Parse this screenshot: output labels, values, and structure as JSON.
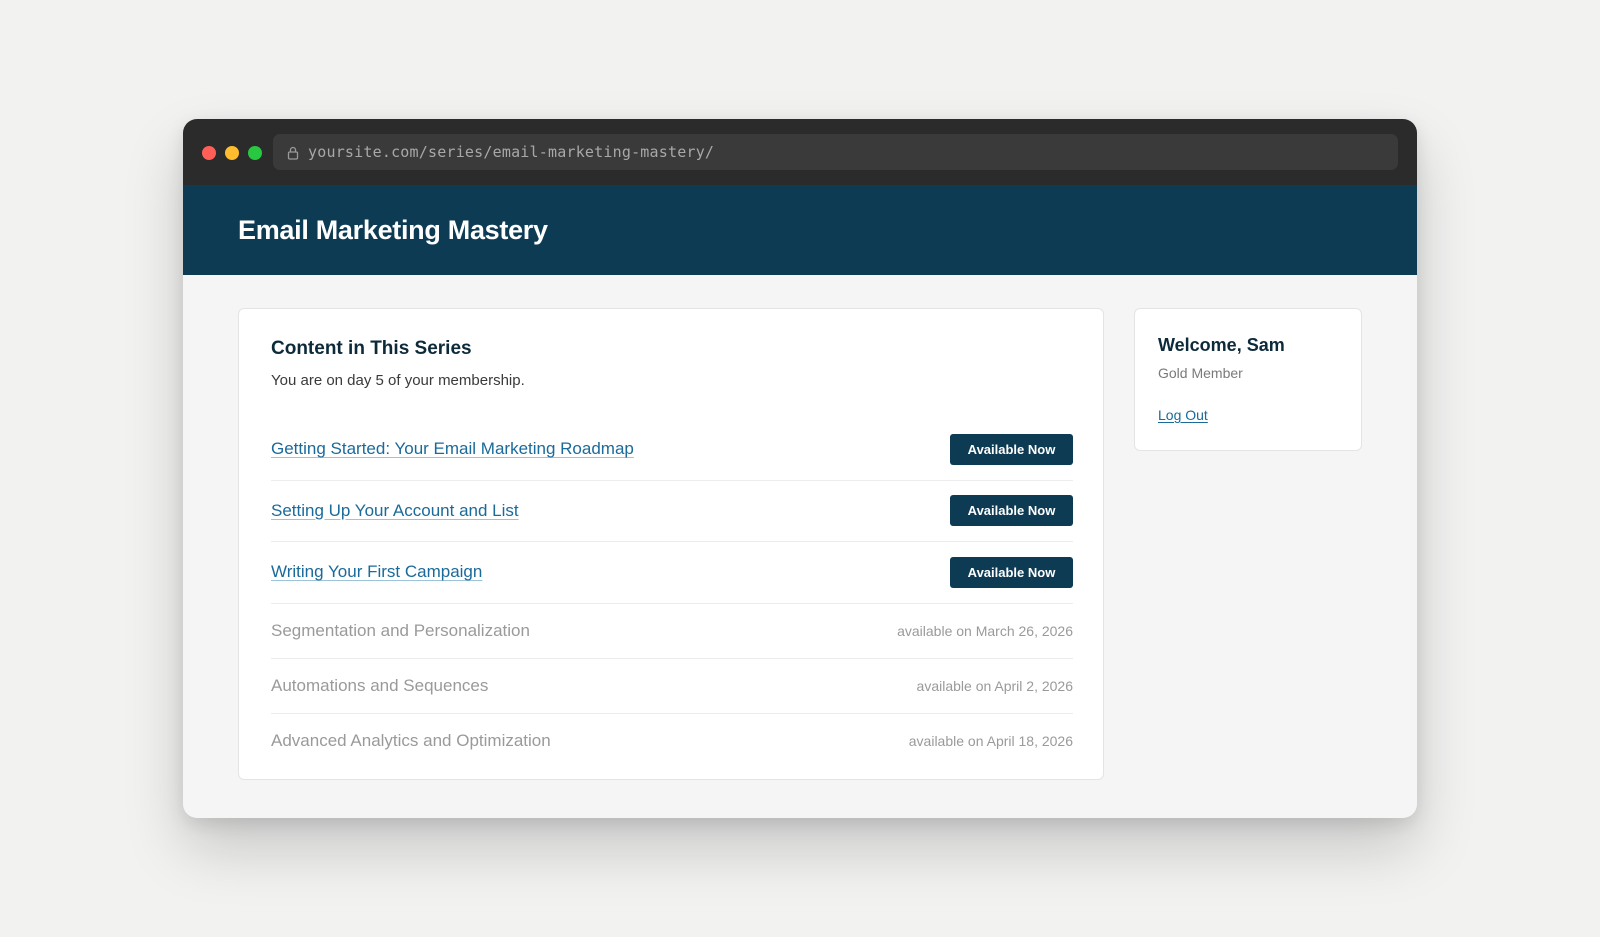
{
  "browser": {
    "url": "yoursite.com/series/email-marketing-mastery/",
    "icons": {
      "traffic_lights": [
        "close-dot",
        "minimize-dot",
        "maximize-dot"
      ],
      "url_icon": "lock-icon"
    },
    "colors": {
      "close": "#ff5f57",
      "minimize": "#febc2e",
      "maximize": "#28c840"
    }
  },
  "header": {
    "title": "Email Marketing Mastery",
    "background": "#0d3b54"
  },
  "series": {
    "heading": "Content in This Series",
    "subtitle": "You are on day 5 of your membership.",
    "items": [
      {
        "title": "Getting Started: Your Email Marketing Roadmap",
        "status": "available",
        "button_label": "Available Now"
      },
      {
        "title": "Setting Up Your Account and List",
        "status": "available",
        "button_label": "Available Now"
      },
      {
        "title": "Writing Your First Campaign",
        "status": "available",
        "button_label": "Available Now"
      },
      {
        "title": "Segmentation and Personalization",
        "status": "locked",
        "availability": "available on March 26, 2026"
      },
      {
        "title": "Automations and Sequences",
        "status": "locked",
        "availability": "available on April 2, 2026"
      },
      {
        "title": "Advanced Analytics and Optimization",
        "status": "locked",
        "availability": "available on April 18, 2026"
      }
    ]
  },
  "sidebar": {
    "welcome": "Welcome, Sam",
    "membership": "Gold Member",
    "logout_label": "Log Out"
  }
}
